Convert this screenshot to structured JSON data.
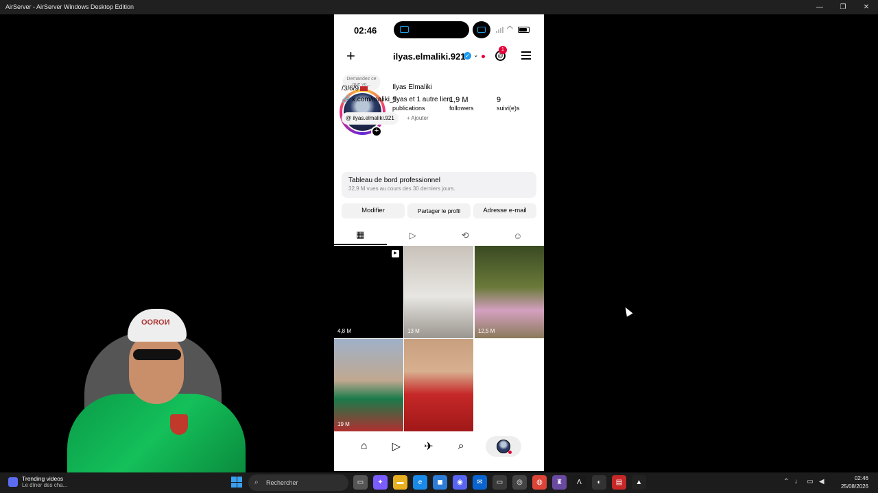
{
  "window": {
    "title": "AirServer - AirServer Windows Desktop Edition",
    "controls": [
      "minimize-icon",
      "maximize-icon",
      "close-icon"
    ]
  },
  "phone": {
    "status_time": "02:46",
    "header": {
      "username": "ilyas.elmaliki.921",
      "notification_count": "1"
    },
    "profile": {
      "note": "Demandez ce que vo...",
      "full_name": "Ilyas Elmaliki",
      "stats": [
        {
          "num": "5",
          "label": "publications"
        },
        {
          "num": "1,9 M",
          "label": "followers"
        },
        {
          "num": "9",
          "label": "suivi(e)s"
        }
      ],
      "bio": "/3/6/9",
      "link": "x.com/maliki_ilyas et 1 autre lien",
      "threads_chip": "ilyas.elmaliki.921",
      "add_chip": "Ajouter"
    },
    "dashboard": {
      "title": "Tableau de bord professionnel",
      "subtitle": "32,9 M vues au cours des 30 derniers jours."
    },
    "actions": [
      "Modifier",
      "Partager le profil",
      "Adresse e-mail"
    ],
    "tabs": [
      "grid-icon",
      "reels-icon",
      "reposts-icon",
      "tagged-icon"
    ],
    "posts": [
      {
        "views": "4,8 M",
        "bg": "#000000"
      },
      {
        "views": "13 M",
        "bg": "#b9b4ad"
      },
      {
        "views": "12,5 M",
        "bg": "#4a5a2e"
      },
      {
        "views": "19 M",
        "bg": "#8a9bb0"
      },
      {
        "views": "",
        "bg": "#c62828"
      }
    ],
    "nav": [
      "home-icon",
      "reels-icon",
      "messages-icon",
      "search-icon",
      "profile-avatar"
    ]
  },
  "taskbar": {
    "widget_title": "Trending videos",
    "widget_sub": "Le dîner des cha...",
    "search_placeholder": "Rechercher",
    "clock_time": "02:46",
    "clock_date": "25/08/2026"
  },
  "colors": {
    "accent": "#1d9bf0",
    "notification": "#e4003a",
    "taskbar": "#1c1c1c"
  }
}
